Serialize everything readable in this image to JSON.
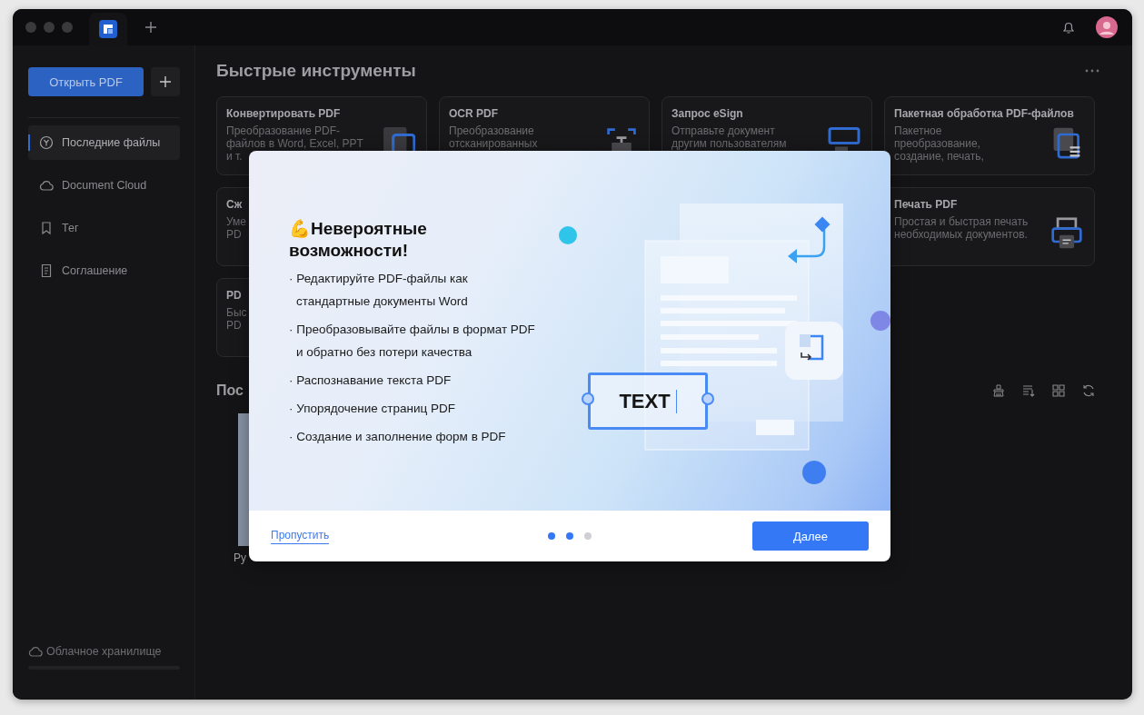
{
  "sidebar": {
    "open_button": "Открыть PDF",
    "items": [
      {
        "label": "Последние файлы",
        "selected": true
      },
      {
        "label": "Document Cloud",
        "selected": false
      },
      {
        "label": "Тег",
        "selected": false
      },
      {
        "label": "Соглашение",
        "selected": false
      }
    ],
    "storage": {
      "label": "Облачное хранилище"
    }
  },
  "quick_tools": {
    "title": "Быстрые инструменты",
    "cards": [
      {
        "title": "Конвертировать PDF",
        "lines": [
          "Преобразование PDF-",
          "файлов в Word, Excel, PPT",
          "и т."
        ]
      },
      {
        "title": "OCR PDF",
        "lines": [
          "Преобразование",
          "отсканированных"
        ]
      },
      {
        "title": "Запрос eSign",
        "lines": [
          "Отправьте документ",
          "другим пользователям"
        ]
      },
      {
        "title": "Пакетная обработка PDF-файлов",
        "lines": [
          "Пакетное",
          "преобразование,",
          "создание, печать,"
        ]
      },
      {
        "title": "Сж",
        "lines": [
          "Уме",
          "PD"
        ]
      },
      {
        "title": "Печать PDF",
        "lines": [
          "Простая и быстрая печать",
          "необходимых документов."
        ]
      },
      {
        "title": "PD",
        "lines": [
          "Быс",
          "PD"
        ]
      }
    ]
  },
  "recent": {
    "title": "Пос",
    "files": [
      {
        "name": "Ру"
      }
    ]
  },
  "onboarding_dialog": {
    "heading": "💪Невероятные возможности!",
    "features": [
      "· Редактируйте PDF-файлы как стандартные документы Word",
      "· Преобразовывайте файлы в формат PDF и обратно без потери качества",
      "· Распознавание текста PDF",
      "· Упорядочение страниц PDF",
      "· Создание и заполнение форм в PDF"
    ],
    "illustration_text": "TEXT",
    "skip_link": "Пропустить",
    "pages": [
      {
        "active": true
      },
      {
        "active": true
      },
      {
        "active": false
      }
    ],
    "next_button": "Далее"
  }
}
